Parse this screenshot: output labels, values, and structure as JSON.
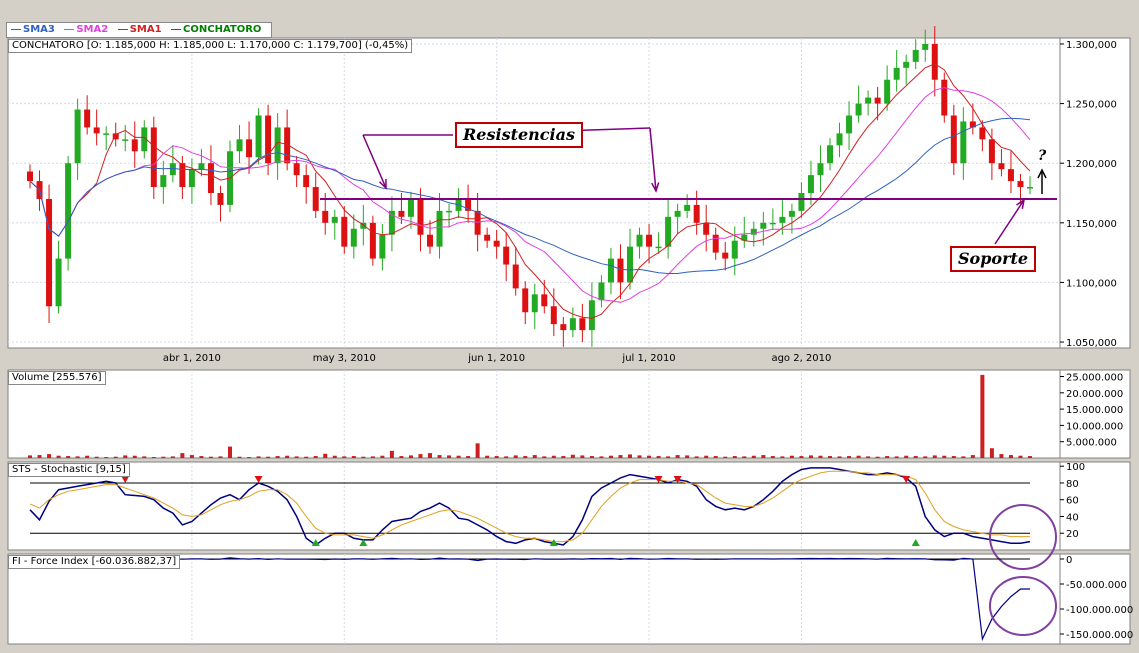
{
  "legend": [
    {
      "name": "SMA3",
      "color": "#3060c0"
    },
    {
      "name": "SMA2",
      "color": "#e040e0"
    },
    {
      "name": "SMA1",
      "color": "#d02020"
    },
    {
      "name": "CONCHATORO",
      "color": "#008000"
    }
  ],
  "price_info": "CONCHATORO [O: 1.185,000  H: 1.185,000  L: 1.170,000  C: 1.179,700] (-0,45%)",
  "volume_label": "Volume [255.576]",
  "stoch_label": "STS - Stochastic [9,15]",
  "force_label": "FI - Force Index [-60.036.882,37]",
  "annotations": {
    "resistencias": "Resistencias",
    "soporte": "Soporte",
    "question": "?"
  },
  "colors": {
    "up": "#22aa22",
    "down": "#dd1111",
    "sma1": "#d02020",
    "sma2": "#e040e0",
    "sma3": "#3060c0",
    "line": "#800080",
    "circle": "#8040a0"
  },
  "chart_data": [
    {
      "type": "candlestick",
      "title": "CONCHATORO",
      "x_ticks": [
        "abr 1, 2010",
        "may 3, 2010",
        "jun 1, 2010",
        "jul 1, 2010",
        "ago 2, 2010"
      ],
      "y_ticks": [
        "1.300,000",
        "1.250,000",
        "1.200,000",
        "1.150,000",
        "1.100,000",
        "1.050,000"
      ],
      "ylim": [
        1045,
        1305
      ],
      "resistance_level": 1170,
      "close": [
        1185,
        1170,
        1080,
        1120,
        1200,
        1245,
        1230,
        1225,
        1225,
        1220,
        1220,
        1210,
        1230,
        1180,
        1190,
        1200,
        1180,
        1195,
        1200,
        1175,
        1165,
        1210,
        1220,
        1205,
        1240,
        1200,
        1230,
        1200,
        1190,
        1180,
        1160,
        1150,
        1155,
        1130,
        1145,
        1150,
        1120,
        1140,
        1160,
        1155,
        1170,
        1140,
        1130,
        1160,
        1160,
        1170,
        1160,
        1140,
        1135,
        1130,
        1115,
        1095,
        1075,
        1090,
        1080,
        1065,
        1060,
        1070,
        1060,
        1085,
        1100,
        1120,
        1100,
        1130,
        1140,
        1130,
        1130,
        1155,
        1160,
        1165,
        1150,
        1140,
        1125,
        1120,
        1135,
        1140,
        1145,
        1150,
        1150,
        1155,
        1160,
        1175,
        1190,
        1200,
        1215,
        1225,
        1240,
        1250,
        1255,
        1250,
        1270,
        1280,
        1285,
        1295,
        1300,
        1270,
        1240,
        1200,
        1235,
        1230,
        1220,
        1200,
        1195,
        1185,
        1180,
        1180
      ]
    },
    {
      "type": "bar",
      "title": "Volume",
      "y_ticks": [
        "25.000.000",
        "20.000.000",
        "15.000.000",
        "10.000.000",
        "5.000.000"
      ],
      "ylim": [
        0,
        27000000
      ],
      "values": [
        800000,
        900000,
        1200000,
        700000,
        600000,
        500000,
        700000,
        400000,
        300000,
        400000,
        800000,
        700000,
        500000,
        300000,
        400000,
        500000,
        1500000,
        900000,
        600000,
        400000,
        500000,
        3500000,
        400000,
        300000,
        500000,
        400000,
        600000,
        700000,
        500000,
        400000,
        600000,
        1300000,
        700000,
        500000,
        600000,
        400000,
        500000,
        700000,
        2200000,
        600000,
        800000,
        1200000,
        1500000,
        900000,
        800000,
        700000,
        600000,
        4500000,
        700000,
        600000,
        500000,
        800000,
        600000,
        900000,
        500000,
        700000,
        600000,
        1000000,
        800000,
        600000,
        500000,
        700000,
        900000,
        1100000,
        800000,
        700000,
        600000,
        500000,
        900000,
        800000,
        500000,
        700000,
        600000,
        400000,
        600000,
        500000,
        700000,
        900000,
        600000,
        500000,
        700000,
        600000,
        800000,
        700000,
        600000,
        500000,
        600000,
        700000,
        500000,
        400000,
        600000,
        500000,
        700000,
        600000,
        500000,
        800000,
        700000,
        600000,
        500000,
        900000,
        25500000,
        3000000,
        1200000,
        900000,
        700000,
        600000
      ]
    },
    {
      "type": "line",
      "title": "STS - Stochastic [9,15]",
      "y_ticks": [
        "100",
        "80",
        "60",
        "40",
        "20"
      ],
      "ylim": [
        0,
        105
      ],
      "series": [
        {
          "values": [
            48,
            36,
            58,
            72,
            74,
            76,
            78,
            80,
            82,
            80,
            66,
            65,
            64,
            60,
            50,
            44,
            30,
            34,
            44,
            54,
            62,
            66,
            60,
            72,
            80,
            76,
            70,
            60,
            40,
            14,
            6,
            14,
            20,
            20,
            14,
            12,
            12,
            24,
            34,
            36,
            38,
            46,
            50,
            56,
            50,
            38,
            36,
            30,
            24,
            16,
            10,
            8,
            12,
            14,
            10,
            8,
            6,
            16,
            36,
            64,
            74,
            80,
            86,
            90,
            88,
            86,
            84,
            80,
            84,
            82,
            76,
            60,
            52,
            48,
            50,
            48,
            52,
            60,
            70,
            82,
            90,
            96,
            98,
            98,
            98,
            96,
            94,
            92,
            90,
            90,
            92,
            90,
            86,
            76,
            40,
            24,
            16,
            20,
            20,
            16,
            14,
            12,
            10,
            8,
            8,
            10
          ]
        },
        {
          "values": [
            55,
            50,
            60,
            66,
            70,
            72,
            74,
            76,
            78,
            78,
            74,
            70,
            66,
            62,
            56,
            50,
            42,
            40,
            42,
            48,
            54,
            58,
            60,
            64,
            70,
            72,
            72,
            66,
            56,
            40,
            26,
            20,
            18,
            18,
            18,
            16,
            14,
            18,
            24,
            30,
            34,
            38,
            42,
            46,
            48,
            46,
            42,
            38,
            32,
            26,
            20,
            16,
            14,
            14,
            12,
            10,
            10,
            12,
            20,
            36,
            52,
            64,
            74,
            80,
            84,
            84,
            84,
            82,
            82,
            80,
            78,
            70,
            62,
            56,
            54,
            52,
            52,
            56,
            62,
            70,
            78,
            84,
            88,
            92,
            94,
            94,
            94,
            92,
            92,
            90,
            90,
            90,
            88,
            84,
            68,
            48,
            34,
            28,
            24,
            22,
            20,
            18,
            18,
            16,
            16,
            16
          ]
        }
      ]
    },
    {
      "type": "line",
      "title": "FI - Force Index [-60.036.882,37]",
      "y_ticks": [
        "0",
        "-50.000.000",
        "-100.000.000",
        "-150.000.000"
      ],
      "ylim": [
        -170000000,
        10000000
      ],
      "series": [
        {
          "values": [
            -2000000,
            -6000000,
            -1000000,
            1000000,
            500000,
            0,
            -500000,
            0,
            500000,
            -300000,
            0,
            200000,
            1500000,
            -800000,
            0,
            500000,
            -400000,
            300000,
            200000,
            -600000,
            -300000,
            2500000,
            600000,
            -200000,
            800000,
            -700000,
            500000,
            -400000,
            -300000,
            -400000,
            -600000,
            -1000000,
            100000,
            -500000,
            300000,
            200000,
            -600000,
            400000,
            1500000,
            -100000,
            500000,
            -700000,
            -400000,
            1800000,
            0,
            300000,
            -200000,
            -3000000,
            -200000,
            -100000,
            -400000,
            -600000,
            -900000,
            500000,
            -300000,
            -400000,
            -200000,
            300000,
            -300000,
            800000,
            600000,
            1100000,
            -800000,
            1400000,
            600000,
            -400000,
            0,
            1000000,
            400000,
            200000,
            -500000,
            -400000,
            -600000,
            -200000,
            500000,
            200000,
            200000,
            300000,
            0,
            200000,
            300000,
            800000,
            1000000,
            700000,
            900000,
            600000,
            1000000,
            700000,
            300000,
            -200000,
            1200000,
            600000,
            300000,
            600000,
            300000,
            -1500000,
            -1800000,
            -2200000,
            1500000,
            -300000,
            -160000000,
            -120000000,
            -95000000,
            -75000000,
            -60000000,
            -60036882
          ]
        }
      ]
    }
  ]
}
